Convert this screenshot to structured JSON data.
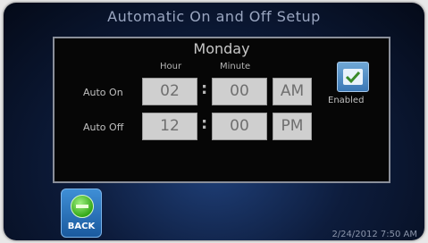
{
  "screen": {
    "title": "Automatic On and Off Setup"
  },
  "dialog": {
    "day": "Monday",
    "columns": {
      "hour": "Hour",
      "minute": "Minute"
    },
    "auto_on": {
      "label": "Auto On",
      "hour": "02",
      "minute": "00",
      "ampm": "AM"
    },
    "auto_off": {
      "label": "Auto Off",
      "hour": "12",
      "minute": "00",
      "ampm": "PM"
    },
    "enabled": {
      "label": "Enabled",
      "checked": true
    },
    "colon": ":"
  },
  "footer": {
    "back_label": "BACK",
    "timestamp": "2/24/2012 7:50 AM"
  },
  "colors": {
    "field_bg": "#cfcfcf",
    "dialog_bg": "#060606",
    "accent_blue": "#3b78b6",
    "back_green": "#34a818"
  }
}
